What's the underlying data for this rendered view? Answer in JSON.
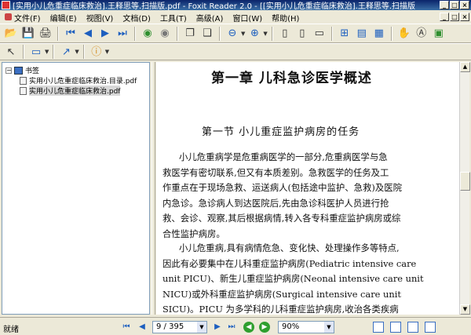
{
  "window": {
    "title": "[实用小儿危重症临床救治].王释思等.扫描版.pdf - Foxit Reader 2.0 - [[实用小儿危重症临床救治].王释思等.扫描版",
    "buttons": [
      "_",
      "□",
      "×"
    ]
  },
  "menu": {
    "items": [
      "文件(F)",
      "编辑(E)",
      "视图(V)",
      "文档(D)",
      "工具(T)",
      "高级(A)",
      "窗口(W)",
      "帮助(H)"
    ],
    "mdi_buttons": [
      "_",
      "□",
      "×"
    ]
  },
  "bookmarks": {
    "root": "书签",
    "items": [
      "实用小儿危重症临床救治.目录.pdf",
      "实用小儿危重症临床救治.pdf"
    ],
    "selected_index": 1
  },
  "document": {
    "chapter_title": "第一章 儿科急诊医学概述",
    "section_title": "第一节 小儿重症监护病房的任务",
    "paragraph1": [
      "小儿危重病学是危重病医学的一部分,危重病医学与急",
      "救医学有密切联系,但又有本质差别。急救医学的任务及工",
      "作重点在于现场急救、运送病人(包括途中监护、急救)及医院",
      "内急诊。急诊病人到达医院后,先由急诊科医护人员进行抢",
      "救、会诊、观察,其后根据病情,转入各专科重症监护病房或综",
      "合性监护病房。"
    ],
    "paragraph2": [
      "小儿危重病,具有病情危急、变化快、处理操作多等特点,",
      "因此有必要集中在儿科重症监护病房(Pediatric intensive care",
      "unit PICU)、新生儿重症监护病房(Neonal intensive care unit",
      "NICU)或外科重症监护病房(Surgical intensive care unit",
      "SICU)。PICU 为多学科的儿科重症监护病房,收治各类疾病"
    ]
  },
  "status": {
    "text": "就绪",
    "page_display": "9 / 395",
    "zoom": "90%"
  }
}
